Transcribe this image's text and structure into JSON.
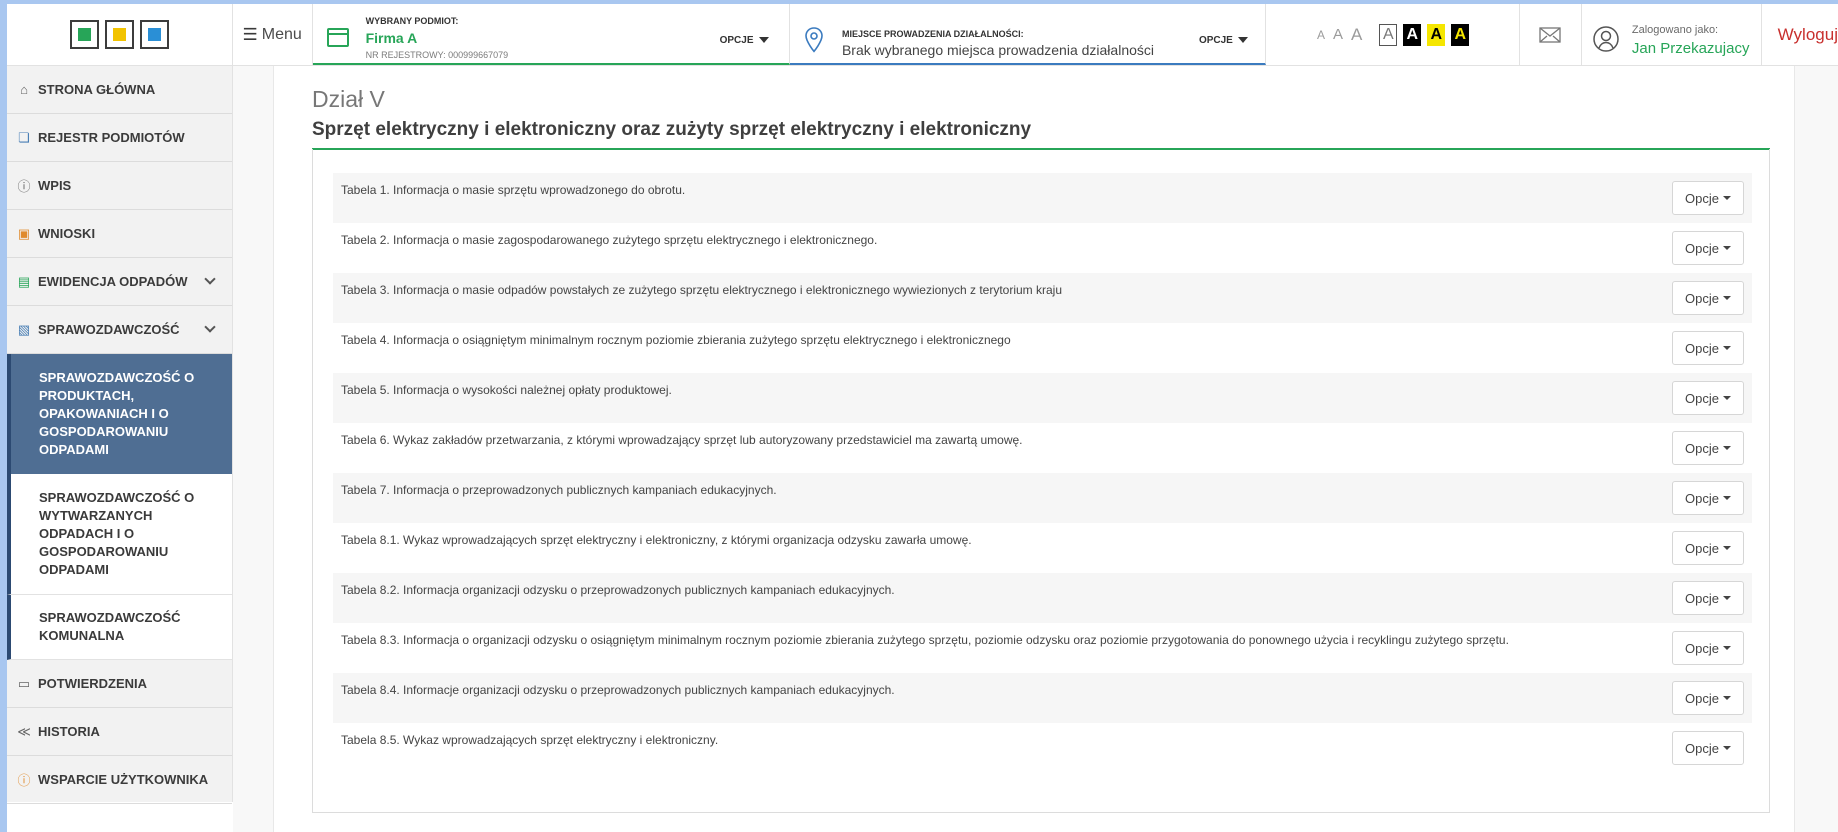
{
  "header": {
    "menu_label": "Menu",
    "subject": {
      "heading": "WYBRANY PODMIOT:",
      "name": "Firma A",
      "reg": "NR REJESTROWY: 000999667079",
      "options": "OPCJE"
    },
    "place": {
      "heading": "MIEJSCE PROWADZENIA DZIAŁALNOŚCI:",
      "text": "Brak wybranego miejsca prowadzenia działalności",
      "options": "OPCJE"
    },
    "font_sizes": [
      "A",
      "A",
      "A"
    ],
    "contrast": [
      "A",
      "A",
      "A",
      "A"
    ],
    "user": {
      "heading": "Zalogowano jako:",
      "name": "Jan Przekazujacy"
    },
    "logout": "Wyloguj"
  },
  "sidebar": {
    "items": [
      {
        "label": "STRONA GŁÓWNA"
      },
      {
        "label": "REJESTR PODMIOTÓW"
      },
      {
        "label": "WPIS"
      },
      {
        "label": "WNIOSKI"
      },
      {
        "label": "EWIDENCJA ODPADÓW"
      },
      {
        "label": "SPRAWOZDAWCZOŚĆ"
      },
      {
        "label": "POTWIERDZENIA"
      },
      {
        "label": "HISTORIA"
      },
      {
        "label": "WSPARCIE UŻYTKOWNIKA"
      }
    ],
    "sub_items": [
      {
        "label": "SPRAWOZDAWCZOŚĆ O PRODUKTACH, OPAKOWANIACH I O GOSPODAROWANIU ODPADAMI"
      },
      {
        "label": "SPRAWOZDAWCZOŚĆ O WYTWARZANYCH ODPADACH I O GOSPODAROWANIU ODPADAMI"
      },
      {
        "label": "SPRAWOZDAWCZOŚĆ KOMUNALNA"
      }
    ]
  },
  "main": {
    "section_number": "Dział V",
    "section_title": "Sprzęt elektryczny i elektroniczny oraz zużyty sprzęt elektryczny i elektroniczny",
    "tables": [
      {
        "label": "Tabela 1. Informacja o masie sprzętu wprowadzonego do obrotu.",
        "button": "Opcje"
      },
      {
        "label": "Tabela 2. Informacja o masie zagospodarowanego zużytego sprzętu elektrycznego i elektronicznego.",
        "button": "Opcje"
      },
      {
        "label": "Tabela 3. Informacja o masie odpadów powstałych ze zużytego sprzętu elektrycznego i elektronicznego wywiezionych z terytorium kraju",
        "button": "Opcje"
      },
      {
        "label": "Tabela 4. Informacja o osiągniętym minimalnym rocznym poziomie zbierania zużytego sprzętu elektrycznego i elektronicznego",
        "button": "Opcje"
      },
      {
        "label": "Tabela 5. Informacja o wysokości należnej opłaty produktowej.",
        "button": "Opcje"
      },
      {
        "label": "Tabela 6. Wykaz zakładów przetwarzania, z którymi wprowadzający sprzęt lub autoryzowany przedstawiciel ma zawartą umowę.",
        "button": "Opcje"
      },
      {
        "label": "Tabela 7. Informacja o przeprowadzonych publicznych kampaniach edukacyjnych.",
        "button": "Opcje"
      },
      {
        "label": "Tabela 8.1. Wykaz wprowadzających sprzęt elektryczny i elektroniczny, z którymi organizacja odzysku zawarła umowę.",
        "button": "Opcje"
      },
      {
        "label": "Tabela 8.2. Informacja organizacji odzysku o przeprowadzonych publicznych kampaniach edukacyjnych.",
        "button": "Opcje"
      },
      {
        "label": "Tabela 8.3. Informacja o organizacji odzysku o osiągniętym minimalnym rocznym poziomie zbierania zużytego sprzętu, poziomie odzysku oraz poziomie przygotowania do ponownego użycia i recyklingu zużytego sprzętu.",
        "button": "Opcje"
      },
      {
        "label": "Tabela 8.4. Informacje organizacji odzysku o przeprowadzonych publicznych kampaniach edukacyjnych.",
        "button": "Opcje"
      },
      {
        "label": "Tabela 8.5. Wykaz wprowadzających sprzęt elektryczny i elektroniczny.",
        "button": "Opcje"
      }
    ]
  },
  "colors": {
    "accent_green": "#27a558",
    "accent_blue": "#3b7bbf",
    "logout_red": "#c8302e",
    "active_nav": "#4f6e93"
  }
}
